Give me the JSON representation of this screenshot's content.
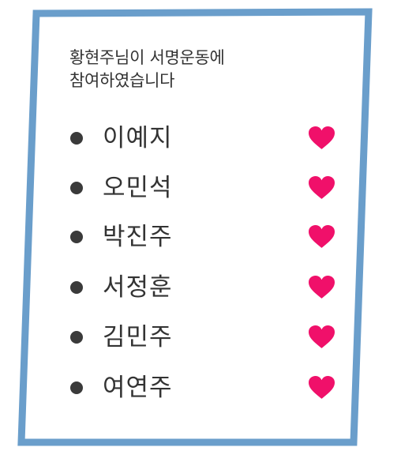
{
  "message": {
    "line1": "황현주님이 서명운동에",
    "line2": "참여하였습니다"
  },
  "participants": [
    {
      "name": "이예지",
      "icon": "heart-icon"
    },
    {
      "name": "오민석",
      "icon": "heart-icon"
    },
    {
      "name": "박진주",
      "icon": "heart-icon"
    },
    {
      "name": "서정훈",
      "icon": "heart-icon"
    },
    {
      "name": "김민주",
      "icon": "heart-icon"
    },
    {
      "name": "여연주",
      "icon": "heart-icon"
    }
  ],
  "colors": {
    "frame": "#6a9ecb",
    "heart": "#f0106a",
    "text": "#333333",
    "bullet": "#3a3a3a"
  }
}
